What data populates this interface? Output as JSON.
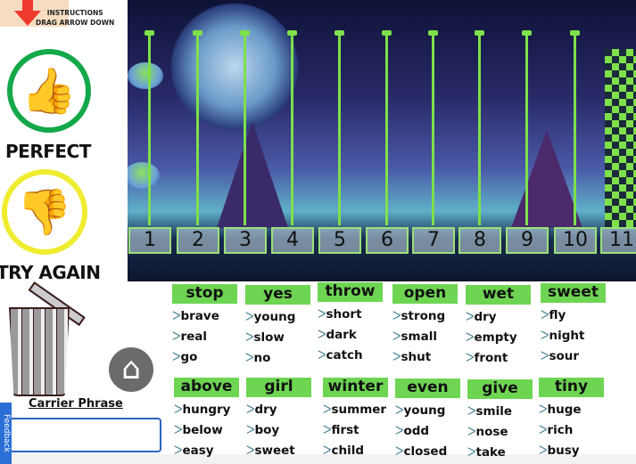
{
  "instructions": {
    "line1": "INSTRUCTIONS",
    "line2": "DRAG ARROW DOWN"
  },
  "feedback_labels": {
    "perfect": "PERFECT",
    "try_again": "TRY AGAIN"
  },
  "carrier_phrase": {
    "label": "Carrier Phrase",
    "value": ""
  },
  "feedback_tab": "Feedback",
  "number_line": [
    "1",
    "2",
    "3",
    "4",
    "5",
    "6",
    "7",
    "8",
    "9",
    "10",
    "11"
  ],
  "word_groups": [
    {
      "header": "stop",
      "words": [
        "brave",
        "real",
        "go"
      ]
    },
    {
      "header": "yes",
      "words": [
        "young",
        "slow",
        "no"
      ]
    },
    {
      "header": "throw",
      "words": [
        "short",
        "dark",
        "catch"
      ]
    },
    {
      "header": "open",
      "words": [
        "strong",
        "small",
        "shut"
      ]
    },
    {
      "header": "wet",
      "words": [
        "dry",
        "empty",
        "front"
      ]
    },
    {
      "header": "sweet",
      "words": [
        "fly",
        "night",
        "sour"
      ]
    },
    {
      "header": "above",
      "words": [
        "hungry",
        "below",
        "easy"
      ]
    },
    {
      "header": "girl",
      "words": [
        "dry",
        "boy",
        "sweet"
      ]
    },
    {
      "header": "winter",
      "words": [
        "summer",
        "first",
        "child"
      ]
    },
    {
      "header": "even",
      "words": [
        "young",
        "odd",
        "closed"
      ]
    },
    {
      "header": "give",
      "words": [
        "smile",
        "nose",
        "take"
      ]
    },
    {
      "header": "tiny",
      "words": [
        "huge",
        "rich",
        "busy"
      ]
    }
  ],
  "colors": {
    "header_green": "#6ed553",
    "pole_green": "#7ee04a",
    "perfect_green": "#13a84a",
    "try_again_yellow": "#f0ec30",
    "input_border": "#2b62c0"
  },
  "icons": {
    "arrow": "red-down-arrow-icon",
    "home": "home-icon",
    "thumb_up": "thumbs-up-icon",
    "thumb_down": "thumbs-down-icon",
    "trash": "trash-can-icon",
    "bullet": "chevron-arrow-icon"
  }
}
